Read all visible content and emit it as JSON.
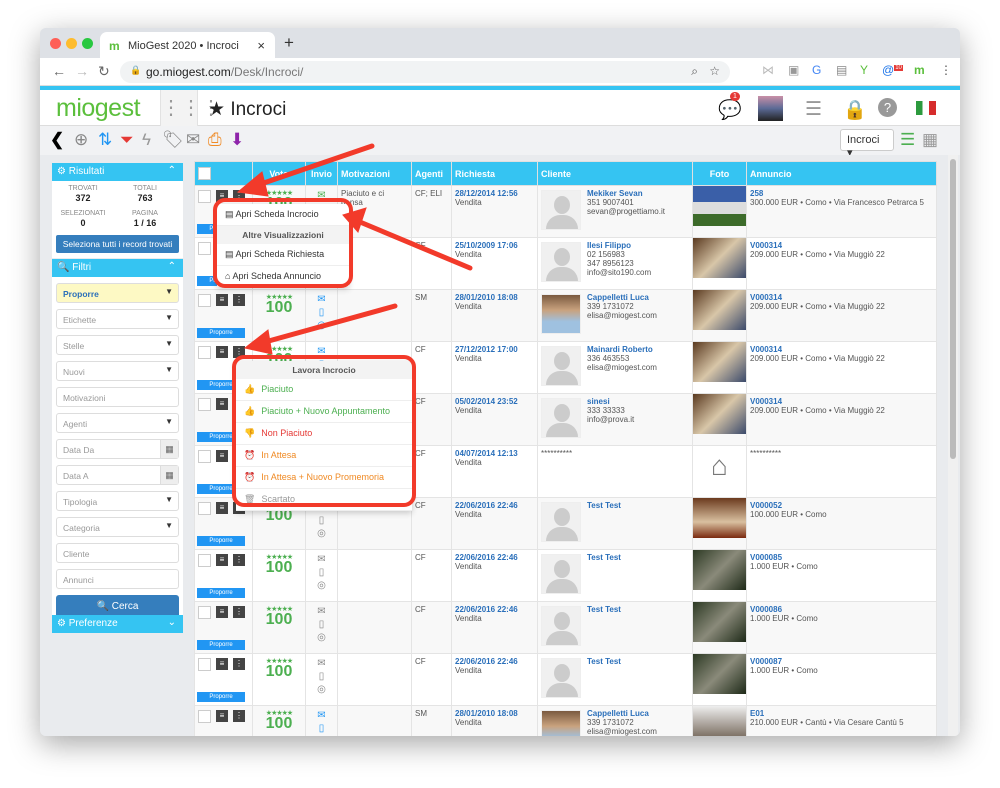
{
  "browser": {
    "tab_title": "MioGest 2020 • Incroci",
    "url_host": "go.miogest.com",
    "url_path": "/Desk/Incroci/",
    "ext_badge": "10"
  },
  "app": {
    "logo": "miogest",
    "page_title": "Incroci",
    "chat_badge": "1",
    "view_select": "Incroci"
  },
  "sidebar": {
    "results": {
      "title": "Risultati",
      "trovati_label": "TROVATI",
      "trovati": "372",
      "totali_label": "TOTALI",
      "totali": "763",
      "selezionati_label": "SELEZIONATI",
      "selezionati": "0",
      "pagina_label": "PAGINA",
      "pagina": "1 / 16",
      "select_all": "Seleziona tutti i record trovati"
    },
    "filters": {
      "title": "Filtri",
      "fields": [
        "Proporre",
        "Etichette",
        "Stelle",
        "Nuovi",
        "Motivazioni",
        "Agenti",
        "Data Da",
        "Data A",
        "Tipologia",
        "Categoria",
        "Cliente",
        "Annunci"
      ],
      "search": "Cerca"
    },
    "prefs": {
      "title": "Preferenze"
    }
  },
  "table": {
    "headers": [
      "",
      "Voto",
      "Invio",
      "Motivazioni",
      "Agenti",
      "Richiesta",
      "Cliente",
      "Foto",
      "Annuncio"
    ],
    "propose_label": "Proporre",
    "stars": "★★★★★",
    "rows": [
      {
        "score": "100",
        "inv": "green",
        "mot": "Piaciuto e ci pensa",
        "ag": "CF; ELI",
        "date": "28/12/2014 12:56",
        "type": "Vendita",
        "client": "Mekiker Sevan",
        "lines": [
          "351 9007401",
          "sevan@progettiamo.it"
        ],
        "photo": false,
        "foto": "ext",
        "ad": "258",
        "addesc": "300.000 EUR • Como • Via Francesco Petrarca 5"
      },
      {
        "score": "100",
        "inv": "blue",
        "mot": "",
        "ag": "CF",
        "date": "25/10/2009 17:06",
        "type": "Vendita",
        "client": "Ilesi Filippo",
        "lines": [
          "02 156983",
          "347 8956123",
          "info@sito190.com"
        ],
        "photo": false,
        "foto": "room",
        "ad": "V000314",
        "addesc": "209.000 EUR • Como • Via Muggiò 22"
      },
      {
        "score": "100",
        "inv": "blue",
        "mot": "",
        "ag": "SM",
        "date": "28/01/2010 18:08",
        "type": "Vendita",
        "client": "Cappelletti Luca",
        "lines": [
          "339 1731072",
          "elisa@miogest.com"
        ],
        "photo": true,
        "foto": "room",
        "ad": "V000314",
        "addesc": "209.000 EUR • Como • Via Muggiò 22"
      },
      {
        "score": "100",
        "inv": "blue",
        "mot": "",
        "ag": "CF",
        "date": "27/12/2012 17:00",
        "type": "Vendita",
        "client": "Mainardi Roberto",
        "lines": [
          "336 463553",
          "elisa@miogest.com"
        ],
        "photo": false,
        "foto": "room",
        "ad": "V000314",
        "addesc": "209.000 EUR • Como • Via Muggiò 22"
      },
      {
        "score": "100",
        "inv": "blue",
        "mot": "",
        "ag": "CF",
        "date": "05/02/2014 23:52",
        "type": "Vendita",
        "client": "sinesi",
        "lines": [
          "333 33333",
          "info@prova.it"
        ],
        "photo": false,
        "foto": "room",
        "ad": "V000314",
        "addesc": "209.000 EUR • Como • Via Muggiò 22"
      },
      {
        "score": "100",
        "inv": "grey",
        "mot": "",
        "ag": "CF",
        "date": "04/07/2014 12:13",
        "type": "Vendita",
        "client": "**********",
        "lines": [],
        "photo": null,
        "foto": "house",
        "ad": "**********",
        "addesc": ""
      },
      {
        "score": "100",
        "inv": "grey",
        "mot": "",
        "ag": "CF",
        "date": "22/06/2016 22:46",
        "type": "Vendita",
        "client": "Test Test",
        "lines": [],
        "photo": false,
        "foto": "int",
        "ad": "V000052",
        "addesc": "100.000 EUR • Como"
      },
      {
        "score": "100",
        "inv": "grey",
        "mot": "",
        "ag": "CF",
        "date": "22/06/2016 22:46",
        "type": "Vendita",
        "client": "Test Test",
        "lines": [],
        "photo": false,
        "foto": "tree",
        "ad": "V000085",
        "addesc": "1.000 EUR • Como"
      },
      {
        "score": "100",
        "inv": "grey",
        "mot": "",
        "ag": "CF",
        "date": "22/06/2016 22:46",
        "type": "Vendita",
        "client": "Test Test",
        "lines": [],
        "photo": false,
        "foto": "tree",
        "ad": "V000086",
        "addesc": "1.000 EUR • Como"
      },
      {
        "score": "100",
        "inv": "grey",
        "mot": "",
        "ag": "CF",
        "date": "22/06/2016 22:46",
        "type": "Vendita",
        "client": "Test Test",
        "lines": [],
        "photo": false,
        "foto": "tree",
        "ad": "V000087",
        "addesc": "1.000 EUR • Como"
      },
      {
        "score": "100",
        "inv": "blue",
        "mot": "",
        "ag": "SM",
        "date": "28/01/2010 18:08",
        "type": "Vendita",
        "client": "Cappelletti Luca",
        "lines": [
          "339 1731072",
          "elisa@miogest.com"
        ],
        "photo": true,
        "foto": "int2",
        "ad": "E01",
        "addesc": "210.000 EUR • Cantù • Via Cesare Cantù 5"
      }
    ]
  },
  "menu_view": {
    "open": "Apri Scheda Incrocio",
    "section": "Altre Visualizzazioni",
    "richiesta": "Apri Scheda Richiesta",
    "annuncio": "Apri Scheda Annuncio"
  },
  "menu_work": {
    "title": "Lavora Incrocio",
    "items": [
      {
        "label": "Piaciuto",
        "color": "#4caf50",
        "icon": "👍"
      },
      {
        "label": "Piaciuto + Nuovo Appuntamento",
        "color": "#4caf50",
        "icon": "👍"
      },
      {
        "label": "Non Piaciuto",
        "color": "#e53935",
        "icon": "👎"
      },
      {
        "label": "In Attesa",
        "color": "#f08a24",
        "icon": "⏰"
      },
      {
        "label": "In Attesa + Nuovo Promemoria",
        "color": "#f08a24",
        "icon": "⏰"
      },
      {
        "label": "Scartato",
        "color": "#999999",
        "icon": "🗑"
      }
    ]
  },
  "colors": {
    "accent": "#35c4f2",
    "brand": "#5bbf3c",
    "button": "#357ebd",
    "annotation": "#f23a2a"
  }
}
